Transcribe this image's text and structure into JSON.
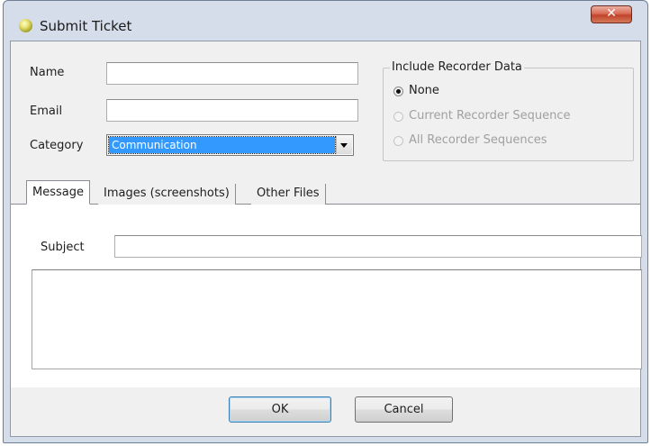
{
  "window": {
    "title": "Submit Ticket",
    "close_glyph": "✕"
  },
  "form": {
    "name_label": "Name",
    "name_value": "",
    "email_label": "Email",
    "email_value": "",
    "category_label": "Category",
    "category_selected": "Communication"
  },
  "recorder": {
    "legend": "Include Recorder Data",
    "options": [
      {
        "label": "None",
        "checked": true,
        "enabled": true
      },
      {
        "label": "Current Recorder Sequence",
        "checked": false,
        "enabled": false
      },
      {
        "label": "All Recorder Sequences",
        "checked": false,
        "enabled": false
      }
    ]
  },
  "tabs": [
    {
      "label": "Message",
      "active": true
    },
    {
      "label": "Images (screenshots)",
      "active": false
    },
    {
      "label": "Other Files",
      "active": false
    }
  ],
  "message": {
    "subject_label": "Subject",
    "subject_value": "",
    "body_value": ""
  },
  "buttons": {
    "ok_label": "OK",
    "cancel_label": "Cancel"
  },
  "icons": {
    "app": "app-orb-icon",
    "close": "close-icon",
    "dropdown": "chevron-down-icon"
  },
  "colors": {
    "selection": "#3399ff",
    "close_button": "#c9452e",
    "titlebar": "#d4dde9"
  }
}
